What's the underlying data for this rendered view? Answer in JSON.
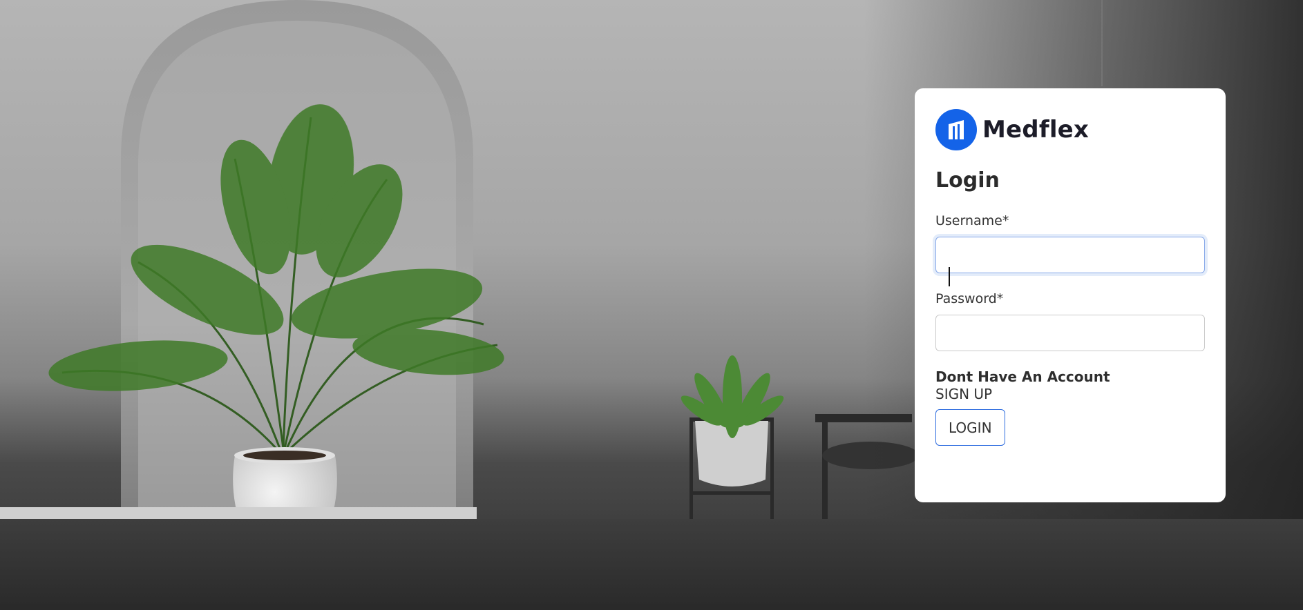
{
  "brand": {
    "name": "Medflex",
    "logo_icon": "medflex-logo-icon",
    "color": "#1463e8"
  },
  "form": {
    "title": "Login",
    "username_label": "Username*",
    "username_value": "",
    "password_label": "Password*",
    "password_value": "",
    "no_account_text": "Dont Have An Account",
    "signup_link": "SIGN UP",
    "login_button": "LOGIN"
  }
}
